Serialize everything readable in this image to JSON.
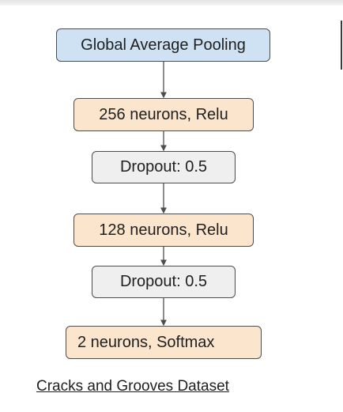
{
  "nodes": {
    "global_average_pooling": "Global Average Pooling",
    "dense_256": "256 neurons, Relu",
    "dropout_1": "Dropout: 0.5",
    "dense_128": "128 neurons, Relu",
    "dropout_2": "Dropout: 0.5",
    "dense_2": "2 neurons, Softmax"
  },
  "caption": "Cracks and Grooves Dataset",
  "colors": {
    "pooling_fill": "#cfe2f3",
    "dense_fill": "#fce5cd",
    "dropout_fill": "#efefef",
    "border": "#4d4d4d",
    "arrow": "#4d4d4d"
  }
}
